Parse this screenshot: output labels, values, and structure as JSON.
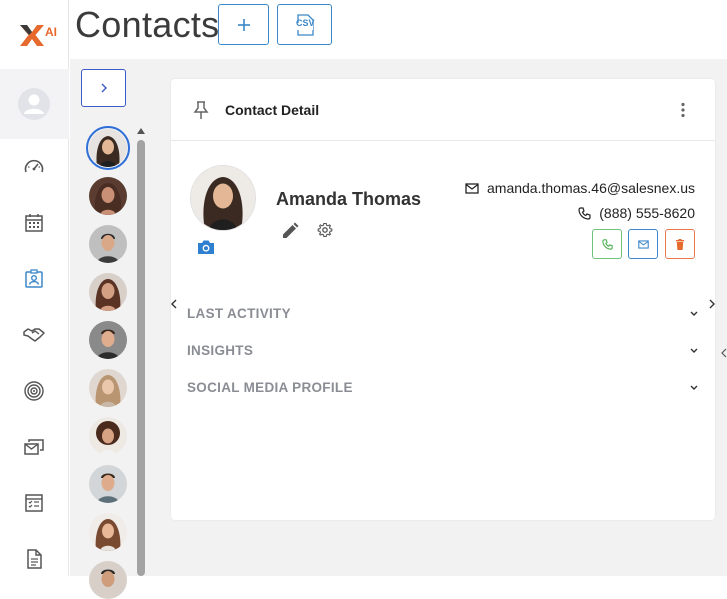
{
  "app": {
    "logo_text": "AI",
    "page_title": "Contacts"
  },
  "colors": {
    "accent": "#3b87c8",
    "logo_orange": "#e8692e",
    "call_green": "#4caf50",
    "delete_red": "#e8692e"
  },
  "header": {
    "add_button_icon": "plus-icon",
    "csv_button_label": "CSV"
  },
  "sidebar": {
    "items": [
      {
        "name": "profile",
        "icon": "user-avatar-icon"
      },
      {
        "name": "dashboard",
        "icon": "speedometer-icon"
      },
      {
        "name": "calendar",
        "icon": "calendar-icon"
      },
      {
        "name": "contacts",
        "icon": "contact-card-icon",
        "active": true
      },
      {
        "name": "deals",
        "icon": "handshake-icon"
      },
      {
        "name": "goals",
        "icon": "target-icon"
      },
      {
        "name": "campaigns",
        "icon": "mail-stack-icon"
      },
      {
        "name": "checklist",
        "icon": "checklist-icon"
      },
      {
        "name": "documents",
        "icon": "document-icon"
      }
    ]
  },
  "contact_list": {
    "expand_icon": "chevron-right-icon"
  },
  "contact_detail": {
    "card_title": "Contact Detail",
    "name": "Amanda Thomas",
    "email": "amanda.thomas.46@salesnex.us",
    "phone": "(888) 555-8620",
    "sections": [
      {
        "label": "LAST ACTIVITY"
      },
      {
        "label": "INSIGHTS"
      },
      {
        "label": "SOCIAL MEDIA PROFILE"
      }
    ]
  }
}
